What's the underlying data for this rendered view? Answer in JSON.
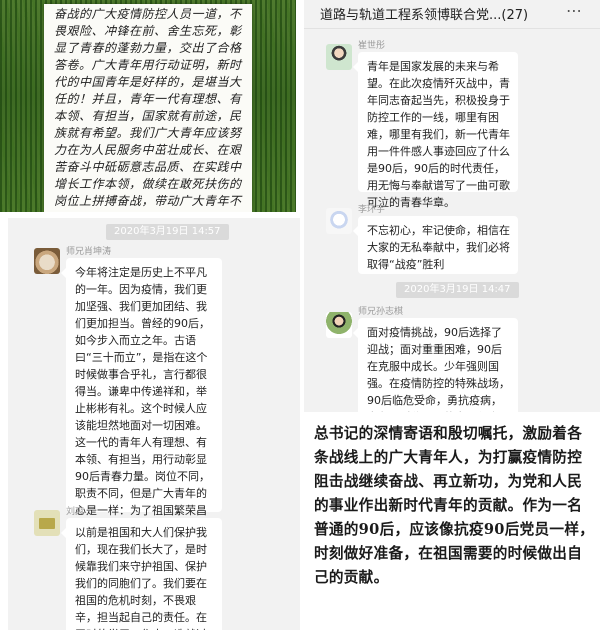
{
  "note_grass": {
    "text": "奋战的广大疫情防控人员一道，不畏艰险、冲锋在前、舍生忘死，彰显了青春的蓬勃力量，交出了合格答卷。广大青年用行动证明，新时代的中国青年是好样的，是堪当大任的！并且，青年一代有理想、有本领、有担当，国家就有前途，民族就有希望。我们广大青年应该努力在为人民服务中茁壮成长、在艰苦奋斗中砥砺意志品质、在实践中增长工作本领，做续在敢死扶伤的岗位上拼搏奋战，带动广大青年不"
  },
  "chat_left": {
    "timestamp": "2020年3月19日 14:57",
    "messages": [
      {
        "sender": "师兄肖坤涛",
        "text": "今年将注定是历史上不平凡的一年。因为疫情，我们更加坚强、我们更加团结、我们更加担当。曾经的90后，如今步入而立之年。古语曰“三十而立”，是指在这个时候做事合乎礼，言行都很得当。谦卑中传递祥和，举止彬彬有礼。这个时候人应该能坦然地面对一切困难。这一代的青年人有理想、有本领、有担当，用行动彰显90后青春力量。岗位不同，职责不同，但是广大青年的心是一样：为了祖国繁荣昌盛、为了人民安居乐业、为了家庭阖家幸福。"
      },
      {
        "sender": "刘爽",
        "text": "以前是祖国和大人们保护我们，现在我们长大了，是时候靠我们来守护祖国、保护我们的同胞们了。我们要在祖国的危机时刻，不畏艰辛，担当起自己的责任。在平时的学习工作中，造就过硬的本领，摆脱冷"
      }
    ]
  },
  "chat_right": {
    "title": "道路与轨道工程系领博联合党...(27)",
    "more_icon": "⋯",
    "timestamp": "2020年3月19日 14:47",
    "messages": [
      {
        "sender": "崔世彤",
        "text": "青年是国家发展的未来与希望。在此次疫情歼灭战中，青年同志奋起当先，积极投身于防控工作的一线，哪里有困难，哪里有我们，新一代青年用一件件感人事迹回应了什么是90后，90后的时代责任，用无悔与奉献谱写了一曲可歌可泣的青春华章。"
      },
      {
        "sender": "李环宇",
        "text": "不忘初心，牢记使命，相信在大家的无私奉献中，我们必将取得“战疫”胜利"
      },
      {
        "sender": "师兄孙志棋",
        "text": "面对疫情挑战，90后选择了迎战；面对重重困难，90后在克服中成长。少年强则国强。在疫情防控的特殊战场，90后临危受命，勇抗疫病，肩负起时代赋予的家国使命，在风雨历练中成长。"
      }
    ]
  },
  "note_bottom": {
    "text": "总书记的深情寄语和殷切嘱托，激励着各条战线上的广大青年人，为打赢疫情防控阻击战继续奋战、再立新功，为党和人民的事业作出新时代青年的贡献。作为一名普通的90后，应该像抗疫90后党员一样，时刻做好准备，在祖国需要的时候做出自己的贡献。"
  },
  "colors": {
    "chat_bg": "#f2f2f2",
    "bubble_bg": "#ffffff",
    "time_pill_bg": "#dadada",
    "grass": "#4c7a2a"
  }
}
